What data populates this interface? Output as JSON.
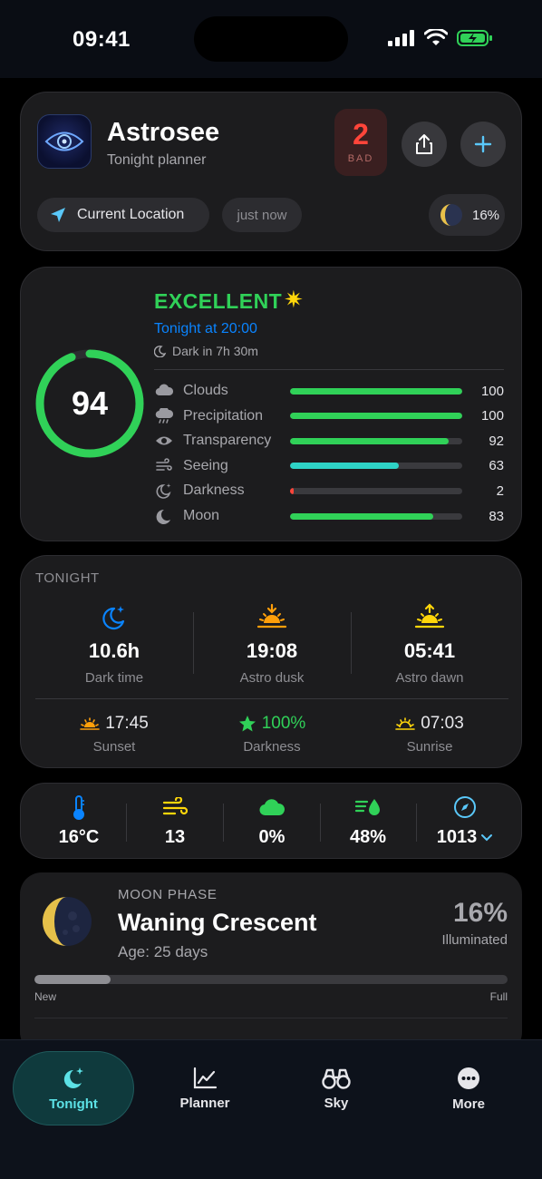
{
  "status_bar": {
    "time": "09:41"
  },
  "header": {
    "app_title": "Astrosee",
    "app_subtitle": "Tonight planner",
    "bad_count": "2",
    "bad_label": "BAD",
    "location": "Current Location",
    "updated": "just now",
    "moon_percent": "16%",
    "icons": [
      "share-icon",
      "plus-icon",
      "location-arrow-icon"
    ]
  },
  "score": {
    "value": "94",
    "value_fraction": 0.94,
    "rating": "EXCELLENT",
    "tonight_at": "Tonight at 20:00",
    "dark_in": "Dark in 7h 30m",
    "colors": {
      "good": "#30d158",
      "fair": "#2ed3c6",
      "bad": "#ff453a"
    },
    "metrics": [
      {
        "name": "Clouds",
        "value": "100",
        "fraction": 1.0,
        "color": "#30d158",
        "icon": "cloud-icon"
      },
      {
        "name": "Precipitation",
        "value": "100",
        "fraction": 1.0,
        "color": "#30d158",
        "icon": "rain-icon"
      },
      {
        "name": "Transparency",
        "value": "92",
        "fraction": 0.92,
        "color": "#30d158",
        "icon": "eye-icon"
      },
      {
        "name": "Seeing",
        "value": "63",
        "fraction": 0.63,
        "color": "#2ed3c6",
        "icon": "wind-icon"
      },
      {
        "name": "Darkness",
        "value": "2",
        "fraction": 0.02,
        "color": "#ff453a",
        "icon": "moon-stars-icon"
      },
      {
        "name": "Moon",
        "value": "83",
        "fraction": 0.83,
        "color": "#30d158",
        "icon": "moon-icon"
      }
    ]
  },
  "tonight": {
    "label": "TONIGHT",
    "top": [
      {
        "value": "10.6h",
        "label": "Dark time",
        "icon": "moon-stars-icon"
      },
      {
        "value": "19:08",
        "label": "Astro dusk",
        "icon": "sunset-icon"
      },
      {
        "value": "05:41",
        "label": "Astro dawn",
        "icon": "sunrise-icon"
      }
    ],
    "bottom": [
      {
        "value": "17:45",
        "label": "Sunset",
        "icon": "sunset-small-icon"
      },
      {
        "value": "100%",
        "label": "Darkness",
        "icon": "star-icon"
      },
      {
        "value": "07:03",
        "label": "Sunrise",
        "icon": "sunrise-small-icon"
      }
    ]
  },
  "weather": [
    {
      "value": "16°C",
      "icon": "thermometer-icon"
    },
    {
      "value": "13",
      "icon": "wind-icon"
    },
    {
      "value": "0%",
      "icon": "cloud-icon"
    },
    {
      "value": "48%",
      "icon": "humidity-icon"
    },
    {
      "value": "1013",
      "icon": "compass-icon"
    }
  ],
  "moon_phase": {
    "label": "MOON PHASE",
    "name": "Waning Crescent",
    "age": "Age: 25 days",
    "percent": "16%",
    "illuminated": "Illuminated",
    "progress_fraction": 0.16,
    "new_label": "New",
    "full_label": "Full"
  },
  "tabs": [
    {
      "label": "Tonight",
      "icon": "moon-stars-icon",
      "active": true
    },
    {
      "label": "Planner",
      "icon": "chart-icon",
      "active": false
    },
    {
      "label": "Sky",
      "icon": "binoculars-icon",
      "active": false
    },
    {
      "label": "More",
      "icon": "more-icon",
      "active": false
    }
  ]
}
